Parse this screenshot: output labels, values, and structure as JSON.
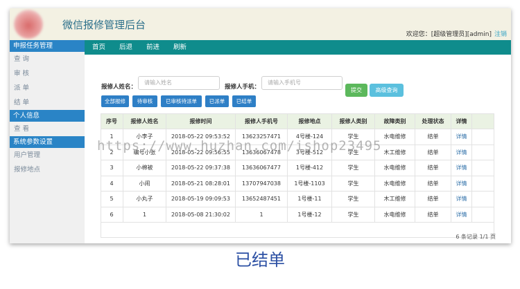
{
  "header": {
    "title": "微信报修管理后台",
    "welcome": "欢迎您：[超级管理员][admin]",
    "logout": "注销"
  },
  "sidebar": {
    "sections": [
      {
        "title": "申报任务管理",
        "items": [
          "查 询",
          "审 核",
          "派 单",
          "结 单"
        ]
      },
      {
        "title": "个人信息",
        "items": [
          "查 看"
        ]
      },
      {
        "title": "系统参数设置",
        "items": [
          "用户管理",
          "报修地点"
        ]
      }
    ]
  },
  "topnav": {
    "items": [
      "首页",
      "后退",
      "前进",
      "刷新"
    ]
  },
  "search": {
    "name_label": "报修人姓名：",
    "name_placeholder": "请输入姓名",
    "phone_label": "报修人手机：",
    "phone_placeholder": "请输入手机号",
    "submit": "提交",
    "advanced": "高级查询"
  },
  "filters": [
    "全部报修",
    "待审核",
    "已审核待派单",
    "已派单",
    "已结单"
  ],
  "table": {
    "columns": [
      "序号",
      "报修人姓名",
      "报修时间",
      "报修人手机号",
      "报修地点",
      "报修人类别",
      "故障类别",
      "处理状态",
      "详情"
    ],
    "rows": [
      [
        "1",
        "小李子",
        "2018-05-22 09:53:52",
        "13623257471",
        "4号楼-124",
        "学生",
        "水电维修",
        "结单",
        "详情"
      ],
      [
        "2",
        "编号小张",
        "2018-05-22 09:56:55",
        "13636067478",
        "3号楼-512",
        "学生",
        "木工维修",
        "结单",
        "详情"
      ],
      [
        "3",
        "小棉被",
        "2018-05-22 09:37:38",
        "13636067477",
        "1号楼-412",
        "学生",
        "水电维修",
        "结单",
        "详情"
      ],
      [
        "4",
        "小闹",
        "2018-05-21 08:28:01",
        "13707947038",
        "1号楼-1103",
        "学生",
        "水电维修",
        "结单",
        "详情"
      ],
      [
        "5",
        "小丸子",
        "2018-05-19 09:09:53",
        "13652487451",
        "1号楼-11",
        "学生",
        "木工维修",
        "结单",
        "详情"
      ],
      [
        "6",
        "1",
        "2018-05-08 21:30:02",
        "1",
        "1号楼-12",
        "学生",
        "水电维修",
        "结单",
        "详情"
      ]
    ],
    "pager": "6 条记录 1/1 页"
  },
  "watermark": "https://www.huzhan.com/ishop23495",
  "caption": "已结单",
  "colors": {
    "accent_blue": "#2a84c6",
    "nav_teal": "#0f8c8c",
    "submit_green": "#5cb85c",
    "advanced_cyan": "#5bc0de",
    "link": "#2e6fa8"
  }
}
